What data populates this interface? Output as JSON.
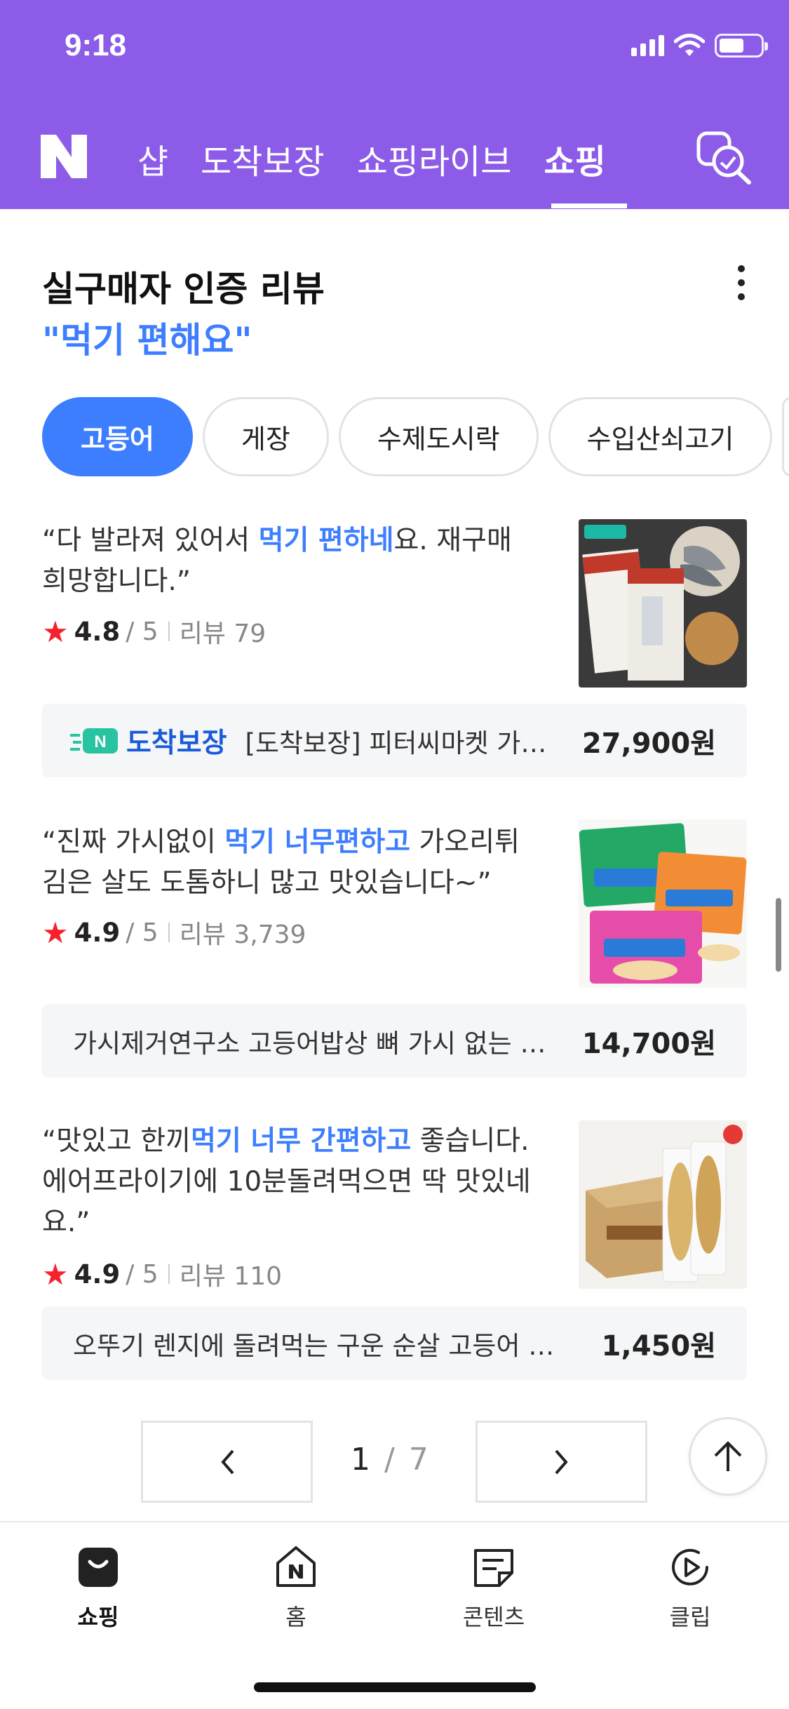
{
  "status_bar": {
    "time": "9:18"
  },
  "nav": {
    "tabs": [
      {
        "label": "샵",
        "partial": true
      },
      {
        "label": "도착보장"
      },
      {
        "label": "쇼핑라이브"
      },
      {
        "label": "쇼핑",
        "active": true
      }
    ],
    "accent_color": "#8c5ce8"
  },
  "section": {
    "title": "실구매자 인증 리뷰",
    "subtitle": "\"먹기 편해요\""
  },
  "chips": [
    "고등어",
    "게장",
    "수제도시락",
    "수입산쇠고기"
  ],
  "reviews": [
    {
      "quote_pre": "“다 발라져 있어서 ",
      "quote_hl": "먹기 편하네",
      "quote_post": "요. 재구매 희망합니다.”",
      "score": "4.8",
      "out_of": "/ 5",
      "review_label": "리뷰 79",
      "badge": "도착보장",
      "product": "[도착보장] 피터씨마켓 가시없는 순살 고등어",
      "price": "27,900원"
    },
    {
      "quote_pre": "“진짜 가시없이 ",
      "quote_hl": "먹기 너무편하고",
      "quote_post": " 가오리튀김은 살도 도톰하니 많고 맛있습니다~”",
      "score": "4.9",
      "out_of": "/ 5",
      "review_label": "리뷰 3,739",
      "product": "가시제거연구소 고등어밥상 뼈 가시 없는 순살 고등어",
      "price": "14,700원"
    },
    {
      "quote_pre": "“맛있고 한끼",
      "quote_hl": "먹기 너무 간편하고",
      "quote_post": " 좋습니다. 에어프라이기에 10분돌려먹으면 딱 맛있네요.”",
      "score": "4.9",
      "out_of": "/ 5",
      "review_label": "리뷰 110",
      "product": "오뚜기 렌지에 돌려먹는 구운 순살 고등어 구이",
      "price": "1,450원"
    }
  ],
  "pagination": {
    "current": "1",
    "separator": "/",
    "total": "7"
  },
  "tabbar": [
    {
      "label": "쇼핑",
      "icon": "shopping-bag-icon",
      "active": true
    },
    {
      "label": "홈",
      "icon": "home-n-icon"
    },
    {
      "label": "콘텐츠",
      "icon": "contents-icon"
    },
    {
      "label": "클립",
      "icon": "clip-play-icon"
    }
  ]
}
